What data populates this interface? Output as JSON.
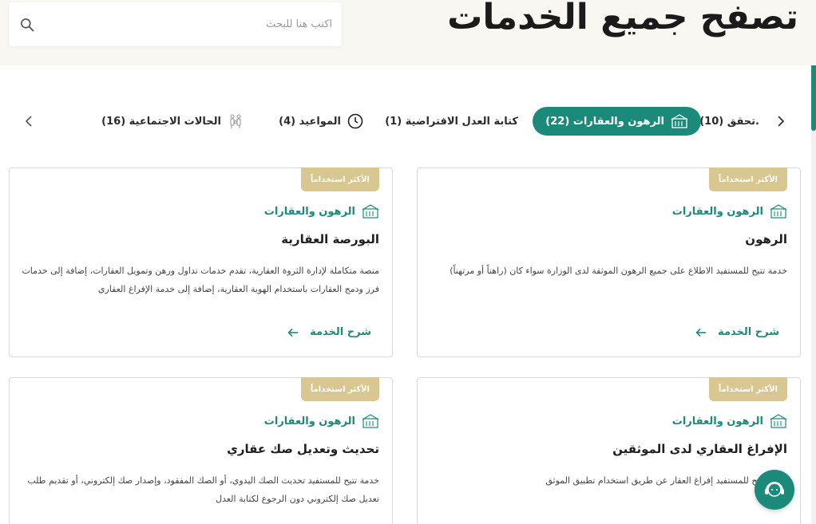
{
  "header": {
    "title": "تصفح جميع الخدمات",
    "search_placeholder": "اكتب هنا للبحث"
  },
  "tabs": [
    {
      "label": ".تحقق (10)",
      "icon": "none"
    },
    {
      "label": "الرهون والعقارات (22)",
      "icon": "building-icon",
      "active": true
    },
    {
      "label": "كتابة العدل الافتراضية (1)",
      "icon": "none"
    },
    {
      "label": "المواعيد (4)",
      "icon": "clock-icon"
    },
    {
      "label": "الحالات الاجتماعية (16)",
      "icon": "family-icon"
    }
  ],
  "cards": [
    {
      "badge": "الأكثر استخداماً",
      "category": "الرهون والعقارات",
      "title": "الرهون",
      "description": "خدمة تتيح للمستفيد الاطلاع على جميع الرهون الموثقة لدى الوزارة سواء كان (راهناً أو مرتهناً)",
      "link": "شرح الخدمة"
    },
    {
      "badge": "الأكثر استخداماً",
      "category": "الرهون والعقارات",
      "title": "البورصة العقارية",
      "description": "منصة متكاملة لإدارة الثروة العقارية، تقدم خدمات تداول ورهن وتمويل العقارات، إضافة إلى خدمات فرز ودمج العقارات باستخدام الهوية العقارية، إضافة إلى خدمة الإفراغ العقاري",
      "link": "شرح الخدمة"
    },
    {
      "badge": "الأكثر استخداماً",
      "category": "الرهون والعقارات",
      "title": "الإفراغ العقاري لدى الموثقين",
      "description": "خدمة تتيح للمستفيد إفراغ العقار عن طريق استخدام تطبيق الموثق"
    },
    {
      "badge": "الأكثر استخداماً",
      "category": "الرهون والعقارات",
      "title": "تحديث وتعديل صك عقاري",
      "description": "خدمة تتيح للمستفيد تحديث الصك اليدوي، أو الصك المفقود، وإصدار صك إلكتروني، أو تقديم طلب تعديل صك إلكتروني دون الرجوع لكتابة العدل"
    }
  ],
  "colors": {
    "accent": "#1b8a7a",
    "badge": "#d9c792",
    "header_bg": "#f8f7f2"
  }
}
